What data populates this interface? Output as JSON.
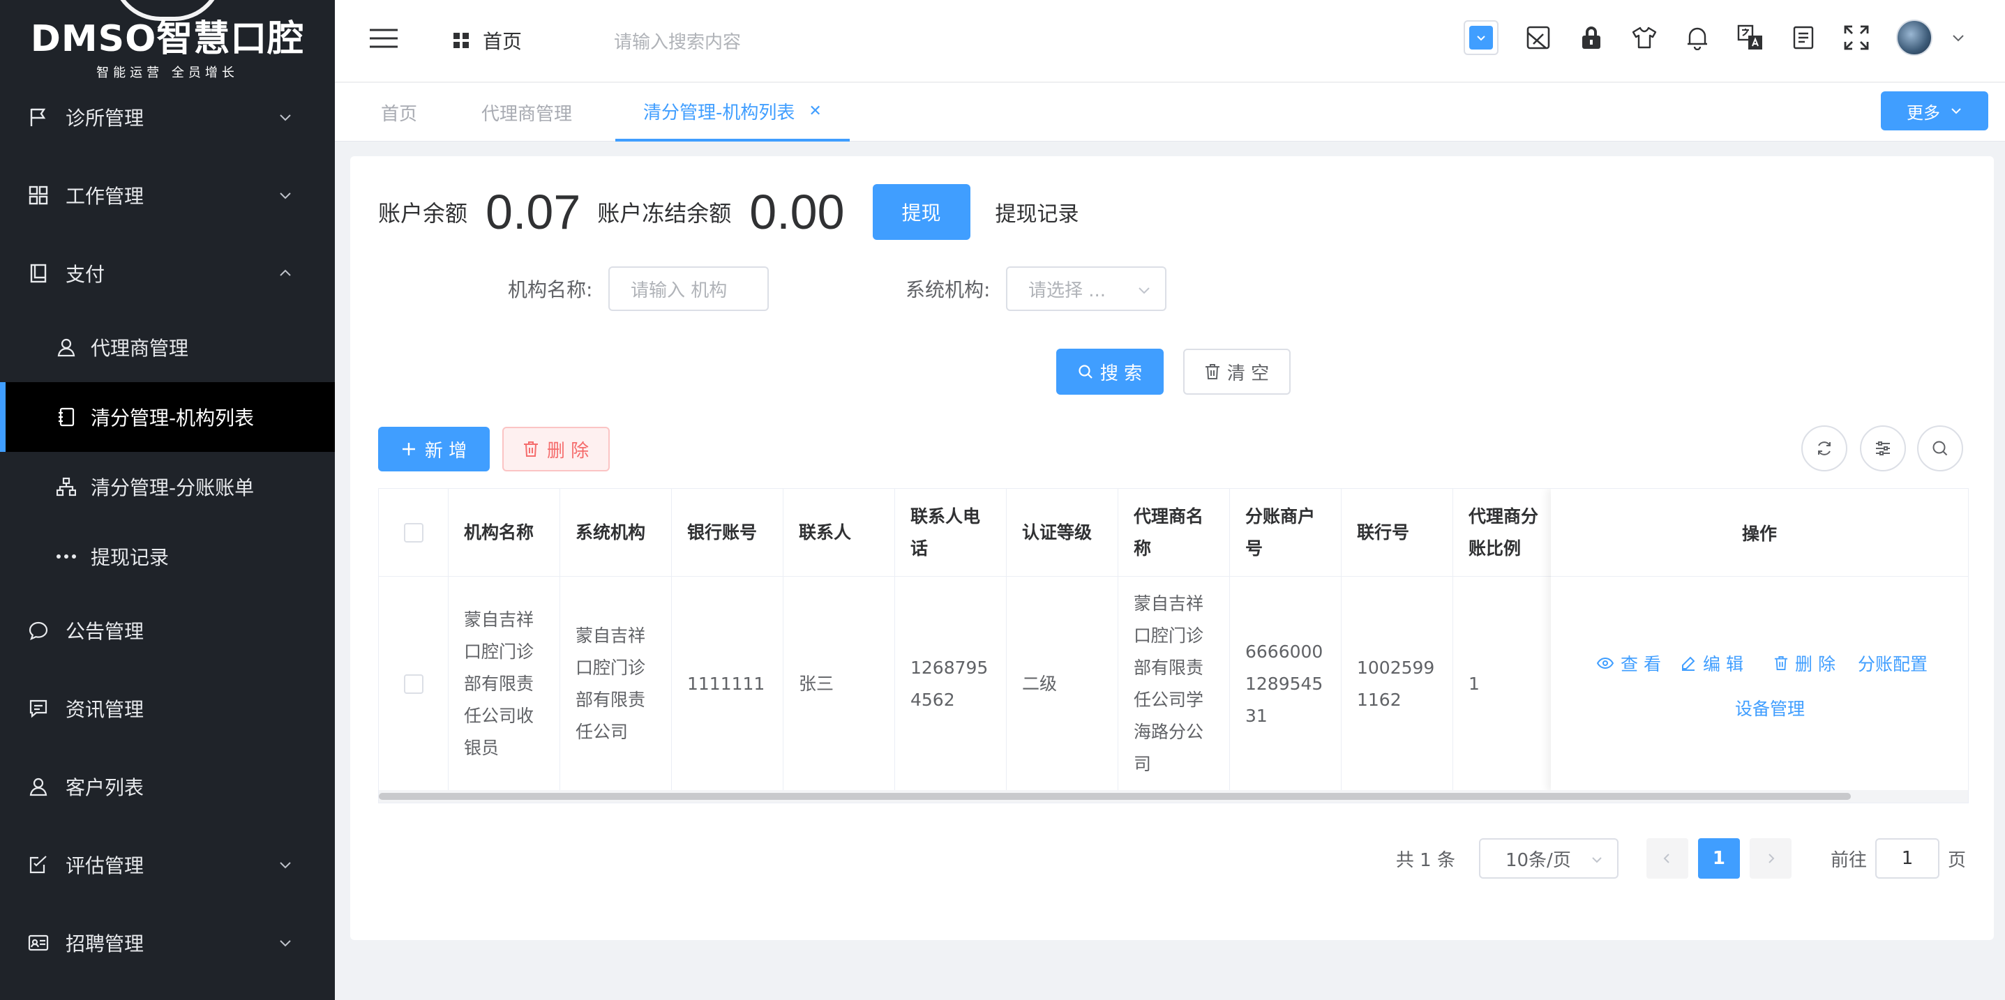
{
  "logo": {
    "main": "DMSO智慧口腔",
    "sub": "智能运营  全员增长"
  },
  "sidebar": {
    "items": [
      {
        "label": "诊所管理",
        "icon": "flag-icon"
      },
      {
        "label": "工作管理",
        "icon": "grid-icon"
      },
      {
        "label": "支付",
        "icon": "book-icon"
      },
      {
        "label": "代理商管理",
        "icon": "user-icon"
      },
      {
        "label": "清分管理-机构列表",
        "icon": "notebook-icon"
      },
      {
        "label": "清分管理-分账账单",
        "icon": "hierarchy-icon"
      },
      {
        "label": "提现记录",
        "icon": "more-dots-icon"
      },
      {
        "label": "公告管理",
        "icon": "chat-bubble-icon"
      },
      {
        "label": "资讯管理",
        "icon": "message-icon"
      },
      {
        "label": "客户列表",
        "icon": "user-icon"
      },
      {
        "label": "评估管理",
        "icon": "edit-doc-icon"
      },
      {
        "label": "招聘管理",
        "icon": "id-card-icon"
      }
    ]
  },
  "header": {
    "home": "首页",
    "search_placeholder": "请输入搜索内容"
  },
  "tabs": [
    {
      "label": "首页"
    },
    {
      "label": "代理商管理"
    },
    {
      "label": "清分管理-机构列表"
    }
  ],
  "more_button": "更多",
  "balance": {
    "label": "账户余额",
    "value": "0.07",
    "frozen_label": "账户冻结余额",
    "frozen_value": "0.00",
    "withdraw_button": "提现",
    "withdraw_record": "提现记录"
  },
  "filters": {
    "org_label": "机构名称:",
    "org_placeholder": "请输入 机构",
    "sys_label": "系统机构:",
    "sys_placeholder": "请选择 ..."
  },
  "actions": {
    "search": "搜 索",
    "clear": "清 空",
    "add": "新 增",
    "delete": "删 除"
  },
  "table": {
    "columns": [
      "机构名称",
      "系统机构",
      "银行账号",
      "联系人",
      "联系人电话",
      "认证等级",
      "代理商名称",
      "分账商户号",
      "联行号",
      "代理商分账比例",
      "操作"
    ],
    "rows": [
      {
        "org_name": "蒙自吉祥口腔门诊部有限责任公司收银员",
        "sys_org": "蒙自吉祥口腔门诊部有限责任公司",
        "bank_account": "1111111",
        "contact": "张三",
        "phone": "12687954562",
        "level": "二级",
        "agent": "蒙自吉祥口腔门诊部有限责任公司学海路分公司",
        "merchant_no": "6666000128954531",
        "bank_no": "10025991162",
        "ratio": "1"
      }
    ],
    "ops": {
      "view": "查 看",
      "edit": "编 辑",
      "delete": "删 除",
      "split": "分账配置",
      "device": "设备管理"
    }
  },
  "pagination": {
    "total": "共 1 条",
    "page_size": "10条/页",
    "current": "1",
    "goto_label": "前往",
    "goto_value": "1",
    "page_suffix": "页"
  },
  "colors": {
    "primary": "#409eff",
    "sidebar": "#1f2329",
    "danger": "#f56c6c"
  }
}
